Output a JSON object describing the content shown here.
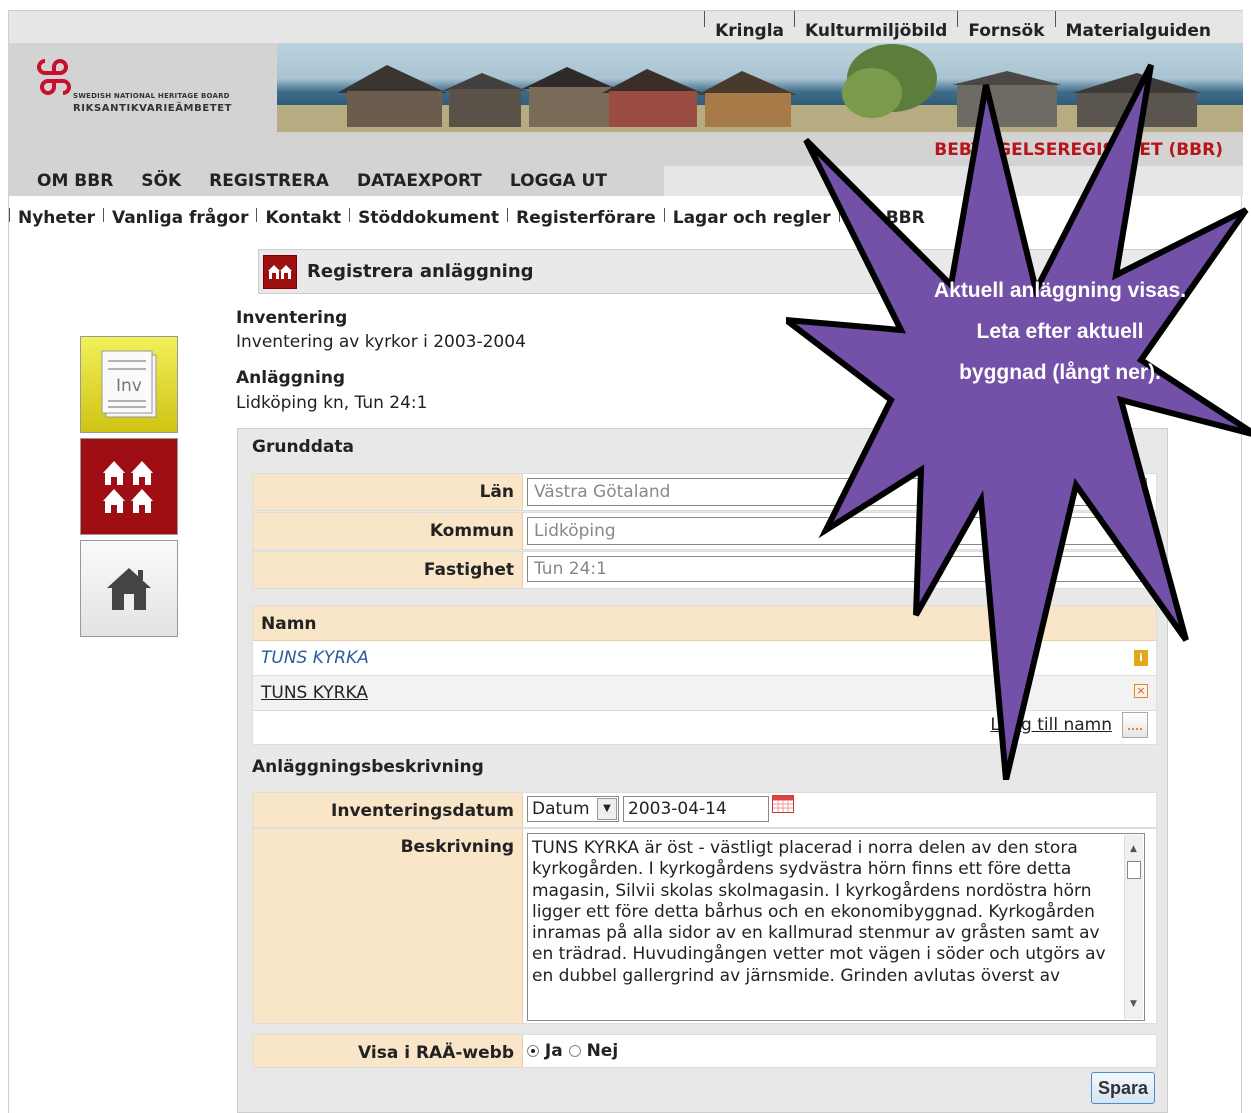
{
  "top_links": [
    "Kringla",
    "Kulturmiljöbild",
    "Fornsök",
    "Materialguiden"
  ],
  "logo": {
    "line1": "SWEDISH NATIONAL HERITAGE BOARD",
    "line2": "RIKSANTIKVARIEÄMBETET"
  },
  "register_title": "BEBYGGELSEREGISTRET (BBR)",
  "main_nav": [
    "OM BBR",
    "SÖK",
    "REGISTRERA",
    "DATAEXPORT",
    "LOGGA UT"
  ],
  "sub_nav": [
    "Nyheter",
    "Vanliga frågor",
    "Kontakt",
    "Stöddokument",
    "Registerförare",
    "Lagar och regler",
    "Om BBR"
  ],
  "page_title": "Registrera anläggning",
  "inventering": {
    "label": "Inventering",
    "value": "Inventering av kyrkor i 2003-2004"
  },
  "anlaggning": {
    "label": "Anläggning",
    "value": "Lidköping kn, Tun 24:1"
  },
  "side_icons": {
    "inv_label": "Inv"
  },
  "grunddata": {
    "heading": "Grunddata",
    "fields": [
      {
        "label": "Län",
        "value": "Västra Götaland"
      },
      {
        "label": "Kommun",
        "value": "Lidköping"
      },
      {
        "label": "Fastighet",
        "value": "Tun 24:1"
      }
    ]
  },
  "names": {
    "header": "Namn",
    "rows": [
      "TUNS KYRKA",
      "TUNS KYRKA"
    ],
    "add_label": "Lägg till namn"
  },
  "description": {
    "heading": "Anläggningsbeskrivning",
    "date_label": "Inventeringsdatum",
    "date_type": "Datum",
    "date_value": "2003-04-14",
    "text_label": "Beskrivning",
    "text": "TUNS KYRKA  är öst - västligt placerad i norra delen av den stora kyrkogården. I kyrkogårdens sydvästra hörn finns ett före detta magasin, Silvii skolas skolmagasin. I kyrkogårdens nordöstra hörn ligger ett före detta bårhus och en ekonomibyggnad. Kyrkogården inramas på alla sidor av en kallmurad stenmur av gråsten samt av en trädrad. Huvudingången vetter mot vägen i söder och utgörs av en dubbel gallergrind av järnsmide. Grinden avlutas överst av",
    "web_label": "Visa i RAÄ-webb",
    "web_yes": "Ja",
    "web_no": "Nej",
    "web_selected": "Ja"
  },
  "save_label": "Spara",
  "callout": "Aktuell anläggning visas. Leta efter aktuell byggnad (långt ner).",
  "colors": {
    "accent_red": "#b8141a",
    "label_bg": "#f9e6c8",
    "callout_purple": "#7451a8"
  }
}
